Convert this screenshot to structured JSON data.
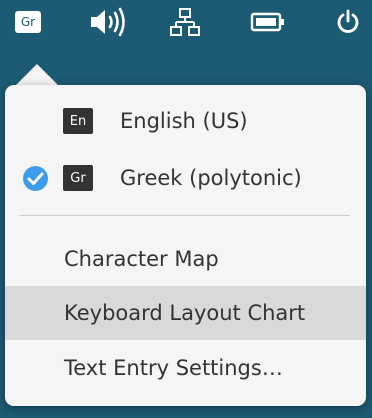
{
  "topbar": {
    "keyboard_indicator": "Gr",
    "icons": [
      "keyboard-layout-icon",
      "volume-icon",
      "network-icon",
      "battery-icon",
      "power-icon"
    ]
  },
  "menu": {
    "languages": [
      {
        "badge": "En",
        "label": "English (US)",
        "selected": false
      },
      {
        "badge": "Gr",
        "label": "Greek (polytonic)",
        "selected": true
      }
    ],
    "actions": [
      {
        "label": "Character Map",
        "highlighted": false
      },
      {
        "label": "Keyboard Layout Chart",
        "highlighted": true
      },
      {
        "label": "Text Entry Settings…",
        "highlighted": false
      }
    ]
  },
  "colors": {
    "desktop_background": "#1d5a73",
    "menu_background": "#f5f5f5",
    "highlight": "#d9d9d9",
    "check_blue": "#3d9be9",
    "text": "#333333"
  }
}
